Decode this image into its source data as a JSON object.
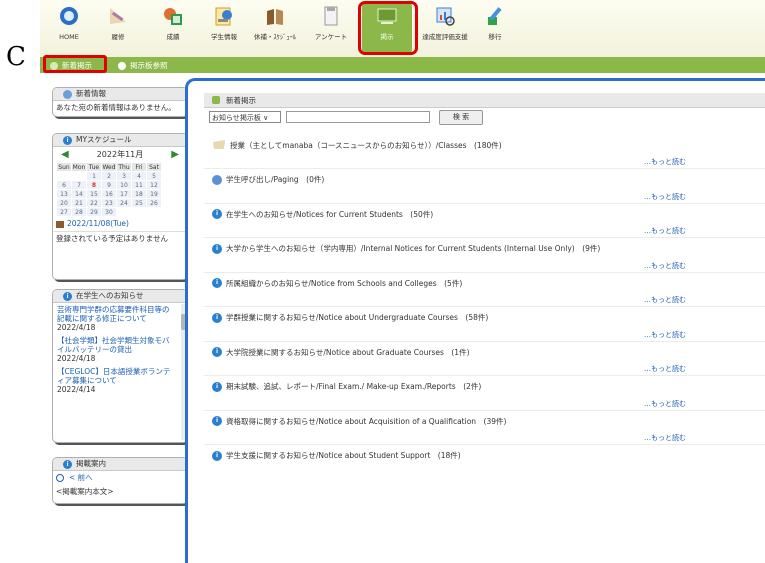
{
  "corner_letter": "C",
  "toolbar": {
    "items": [
      {
        "label": "HOME",
        "icon": "home-icon"
      },
      {
        "label": "履修",
        "icon": "registration-icon"
      },
      {
        "label": "成績",
        "icon": "grades-icon"
      },
      {
        "label": "学生情報",
        "icon": "student-info-icon"
      },
      {
        "label": "休補・ｽｹｼﾞｭｰﾙ",
        "icon": "schedule-icon"
      },
      {
        "label": "アンケート",
        "icon": "survey-icon"
      },
      {
        "label": "掲示",
        "icon": "bulletin-icon"
      },
      {
        "label": "達成度評価支援",
        "icon": "achievement-icon"
      },
      {
        "label": "移行",
        "icon": "migration-icon"
      }
    ],
    "active_index": 6
  },
  "subnav": {
    "new_posts": "新着掲示",
    "browse_board": "掲示板参照"
  },
  "left": {
    "news": {
      "title": "新着情報",
      "text": "あなた宛の新着情報はありません。"
    },
    "schedule": {
      "title": "MYスケジュール",
      "month": "2022年11月",
      "weekdays": [
        "Sun",
        "Mon",
        "Tue",
        "Wed",
        "Thu",
        "Fri",
        "Sat"
      ],
      "weeks": [
        [
          "",
          "",
          "1",
          "2",
          "3",
          "4",
          "5"
        ],
        [
          "6",
          "7",
          "8",
          "9",
          "10",
          "11",
          "12"
        ],
        [
          "13",
          "14",
          "15",
          "16",
          "17",
          "18",
          "19"
        ],
        [
          "20",
          "21",
          "22",
          "23",
          "24",
          "25",
          "26"
        ],
        [
          "27",
          "28",
          "29",
          "30",
          "",
          "",
          ""
        ]
      ],
      "today": "8",
      "date_line": "2022/11/08(Tue)",
      "empty_text": "登録されている予定はありません"
    },
    "current_notices": {
      "title": "在学生へのお知らせ",
      "items": [
        {
          "title": "芸術専門学群の応募要件科目等の記載に関する修正について",
          "date": "2022/4/18"
        },
        {
          "title": "【社会学類】社会学類生対象モバイルバッテリーの貸出",
          "date": "2022/4/18"
        },
        {
          "title": "【CEGLOC】日本語授業ボランティア募集について",
          "date": "2022/4/14"
        }
      ]
    },
    "board_guide": {
      "title": "掲載案内",
      "prev": "< 前へ",
      "body": "<掲載案内本文>"
    }
  },
  "main": {
    "title": "新着掲示",
    "select_value": "お知らせ掲示板 ∨",
    "search_button": "検 索",
    "more_label": "…もっと読む",
    "categories": [
      {
        "icon": "pin",
        "title": "授業（主としてmanaba（コースニュースからのお知らせ））/Classes　(180件)"
      },
      {
        "icon": "person",
        "title": "学生呼び出し/Paging　(0件)"
      },
      {
        "icon": "info",
        "title": "在学生へのお知らせ/Notices for Current Students　(50件)"
      },
      {
        "icon": "info",
        "title": "大学から学生へのお知らせ（学内専用）/Internal Notices for Current Students (Internal Use Only)　(9件)"
      },
      {
        "icon": "info",
        "title": "所属組織からのお知らせ/Notice from Schools and Colleges　(5件)"
      },
      {
        "icon": "info",
        "title": "学群授業に関するお知らせ/Notice about Undergraduate Courses　(58件)"
      },
      {
        "icon": "info",
        "title": "大学院授業に関するお知らせ/Notice about Graduate Courses　(1件)"
      },
      {
        "icon": "info",
        "title": "期末試験、追試、レポート/Final Exam./ Make-up Exam./Reports　(2件)"
      },
      {
        "icon": "info",
        "title": "資格取得に関するお知らせ/Notice about Acquisition of a Qualification　(39件)"
      },
      {
        "icon": "info",
        "title": "学生支援に関するお知らせ/Notice about Student Support　(18件)"
      }
    ]
  },
  "colors": {
    "accent_green": "#8cb84a",
    "highlight_red": "#e00000",
    "highlight_blue": "#2a6fd0"
  }
}
